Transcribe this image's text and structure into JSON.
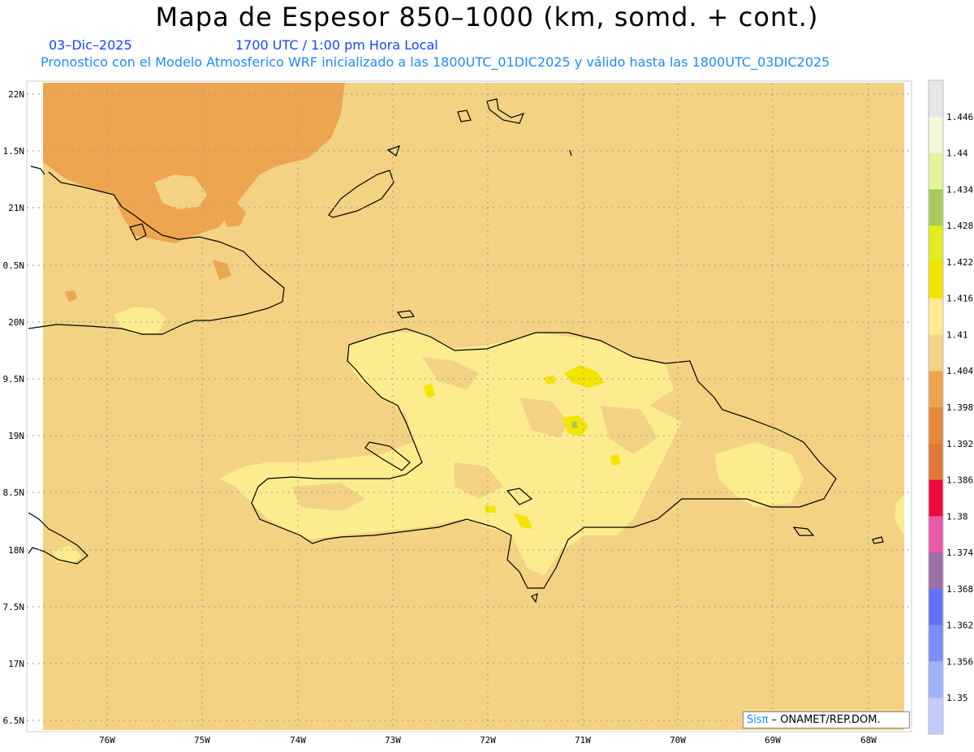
{
  "title": "Mapa de Espesor 850–1000 (km, somd. + cont.)",
  "date": "03–Dic–2025",
  "time": "1700 UTC / 1:00 pm Hora Local",
  "description": "Pronostico con el Modelo Atmosferico WRF inicializado a las 1800UTC_01DIC2025 y válido hasta las  1800UTC_03DIC2025",
  "credit": {
    "brand": "Sisπ",
    "text": "– ONAMET/REP.DOM."
  },
  "lat_labels": [
    "22N",
    "1.5N",
    "21N",
    "0.5N",
    "20N",
    "9.5N",
    "19N",
    "8.5N",
    "18N",
    "7.5N",
    "17N",
    "6.5N"
  ],
  "lon_labels": [
    "76W",
    "75W",
    "74W",
    "73W",
    "72W",
    "71W",
    "70W",
    "69W",
    "68W"
  ],
  "colorbar": {
    "labels": [
      "1.446",
      "1.44",
      "1.434",
      "1.428",
      "1.422",
      "1.416",
      "1.41",
      "1.404",
      "1.398",
      "1.392",
      "1.386",
      "1.38",
      "1.374",
      "1.368",
      "1.362",
      "1.356",
      "1.35"
    ],
    "colors": [
      "#e6e6e6",
      "#f3f6d8",
      "#e3f39a",
      "#a5cc5a",
      "#e2ec1e",
      "#f5e300",
      "#fcec8e",
      "#f3d283",
      "#eea550",
      "#e58a3c",
      "#e07837",
      "#ee0a3f",
      "#ea58a8",
      "#9b6fa8",
      "#6470f2",
      "#7e8ef8",
      "#9fb2fb",
      "#bfccfd"
    ]
  },
  "colors": {
    "background_field": "#f3d283",
    "low_thickness": "#eea550",
    "high_thickness": "#fcec8e",
    "peak_thickness": "#f5e300",
    "coastline": "#000000"
  }
}
